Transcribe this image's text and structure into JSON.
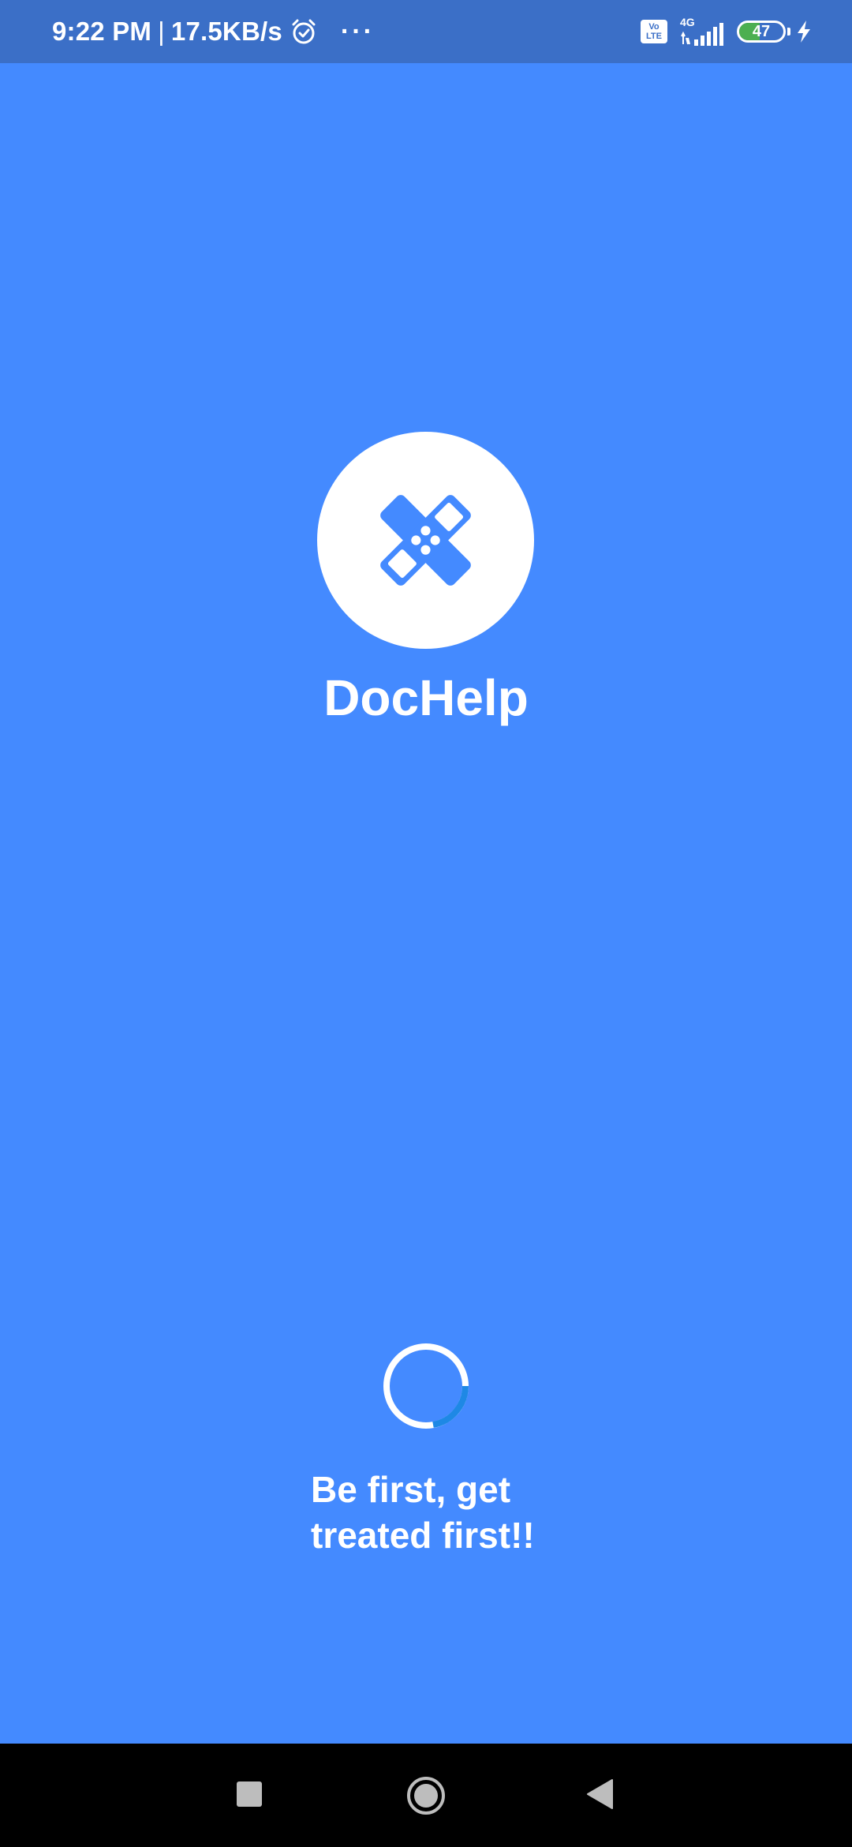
{
  "status_bar": {
    "time": "9:22 PM",
    "separator": "|",
    "network_speed": "17.5KB/s",
    "more_dots": "···",
    "volte_top": "Vo",
    "volte_bottom": "LTE",
    "network_type": "4G",
    "battery_level": "47",
    "battery_fraction": 0.47,
    "icons": [
      "alarm-icon",
      "more-dots-icon",
      "volte-icon",
      "signal-icon",
      "battery-icon",
      "charging-icon"
    ]
  },
  "splash": {
    "app_name": "DocHelp",
    "logo_icon": "bandage-icon",
    "tagline_line1": "Be first, get",
    "tagline_line2": "treated first!!"
  },
  "nav_bar": {
    "icons": [
      "recents-icon",
      "home-icon",
      "back-icon"
    ]
  },
  "colors": {
    "background": "#448aff",
    "status_bar": "#3b6fc7",
    "logo_circle": "#ffffff",
    "spinner_accent": "#1e88e5",
    "battery_fill": "#4caf50"
  }
}
